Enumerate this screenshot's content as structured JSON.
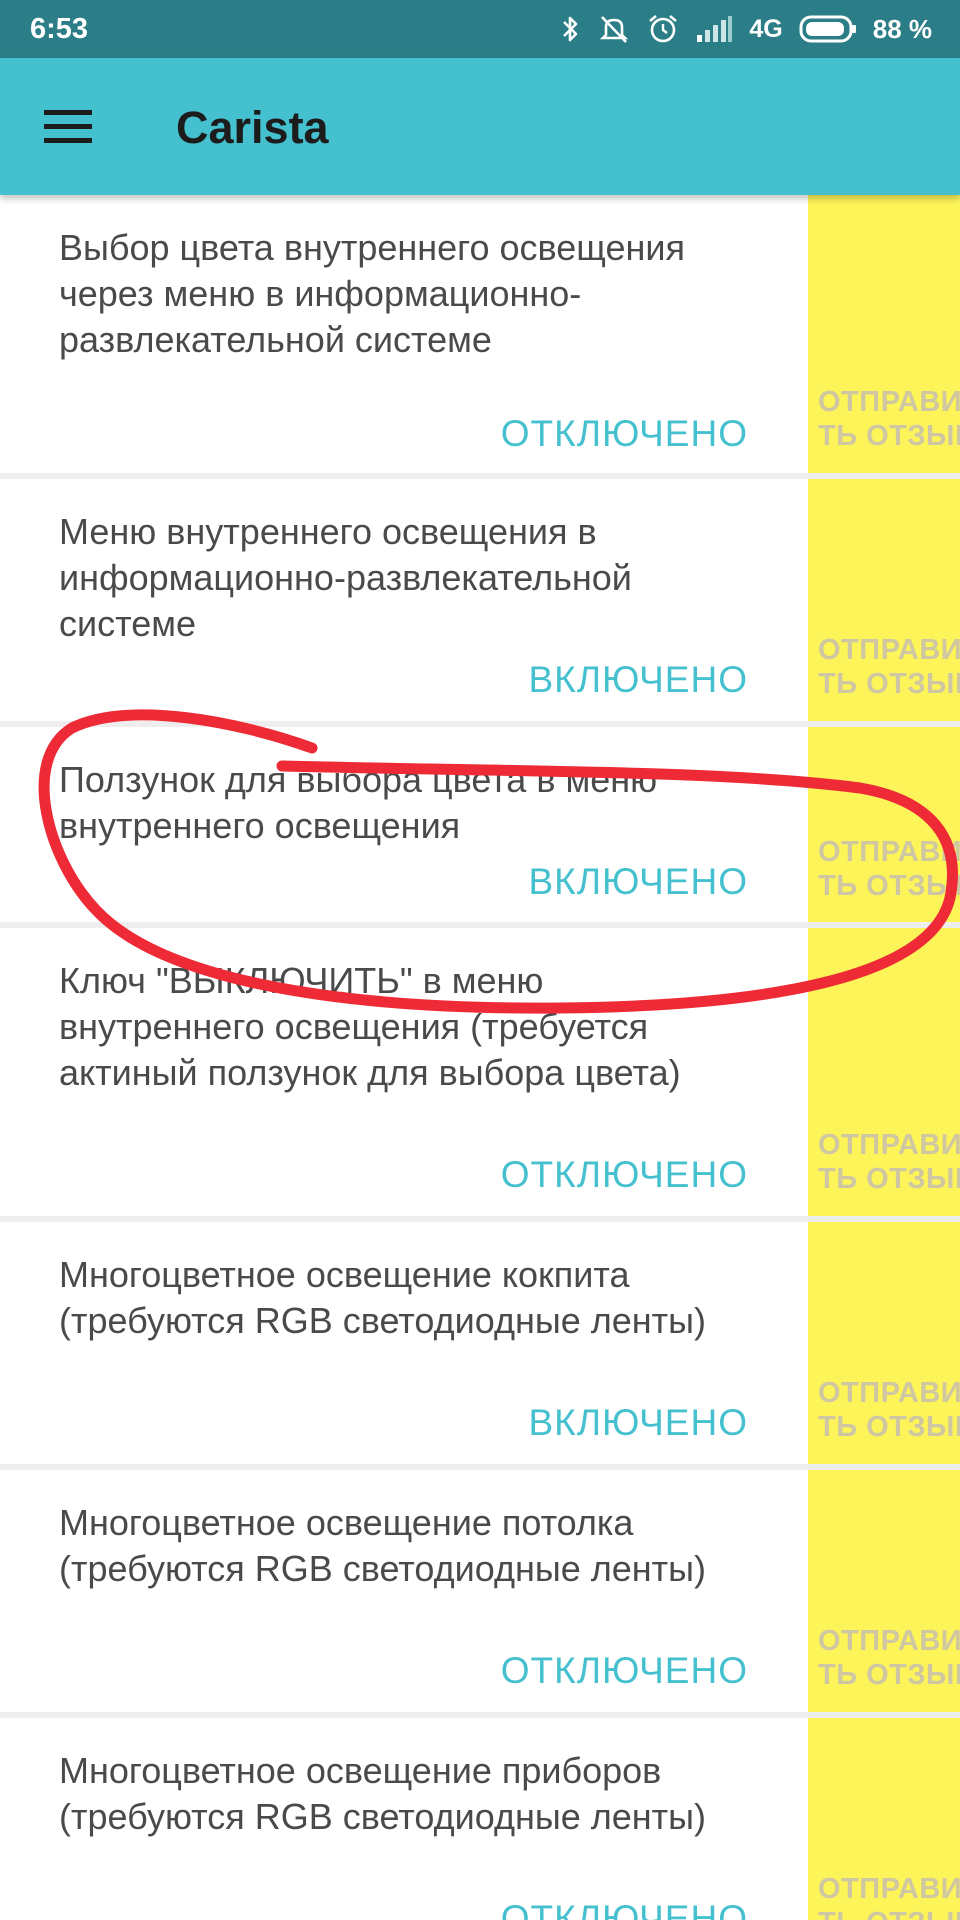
{
  "status_bar": {
    "time": "6:53",
    "network": "4G",
    "battery": "88 %"
  },
  "app_bar": {
    "title": "Carista"
  },
  "feedback_label": "ОТПРАВИ\nТЬ ОТЗЫВ",
  "items": [
    {
      "title": "Выбор цвета внутреннего освещения через меню в информационно-развлекательной системе",
      "status": "ОТКЛЮЧЕНО"
    },
    {
      "title": "Меню внутреннего освещения в информационно-развлекательной системе",
      "status": "ВКЛЮЧЕНО"
    },
    {
      "title": "Ползунок для выбора цвета в меню внутреннего освещения",
      "status": "ВКЛЮЧЕНО"
    },
    {
      "title": "Ключ \"ВЫКЛЮЧИТЬ\" в меню внутреннего освещения (требуется актиный ползунок для выбора цвета)",
      "status": "ОТКЛЮЧЕНО"
    },
    {
      "title": "Многоцветное освещение кокпита (требуются RGB светодиодные ленты)",
      "status": "ВКЛЮЧЕНО"
    },
    {
      "title": "Многоцветное освещение потолка (требуются RGB светодиодные ленты)",
      "status": "ОТКЛЮЧЕНО"
    },
    {
      "title": "Многоцветное освещение приборов (требуются RGB светодиодные ленты)",
      "status": "ОТКЛЮЧЕНО"
    }
  ],
  "colors": {
    "app_bar": "#45c0cf",
    "status_bar": "#2b7e87",
    "accent": "#45c0cf",
    "feedback_bg": "#fdf45a",
    "annotation": "#ee2a36"
  },
  "icons": [
    "menu-icon",
    "bluetooth-icon",
    "mute-icon",
    "alarm-icon",
    "signal-icon",
    "battery-icon"
  ]
}
